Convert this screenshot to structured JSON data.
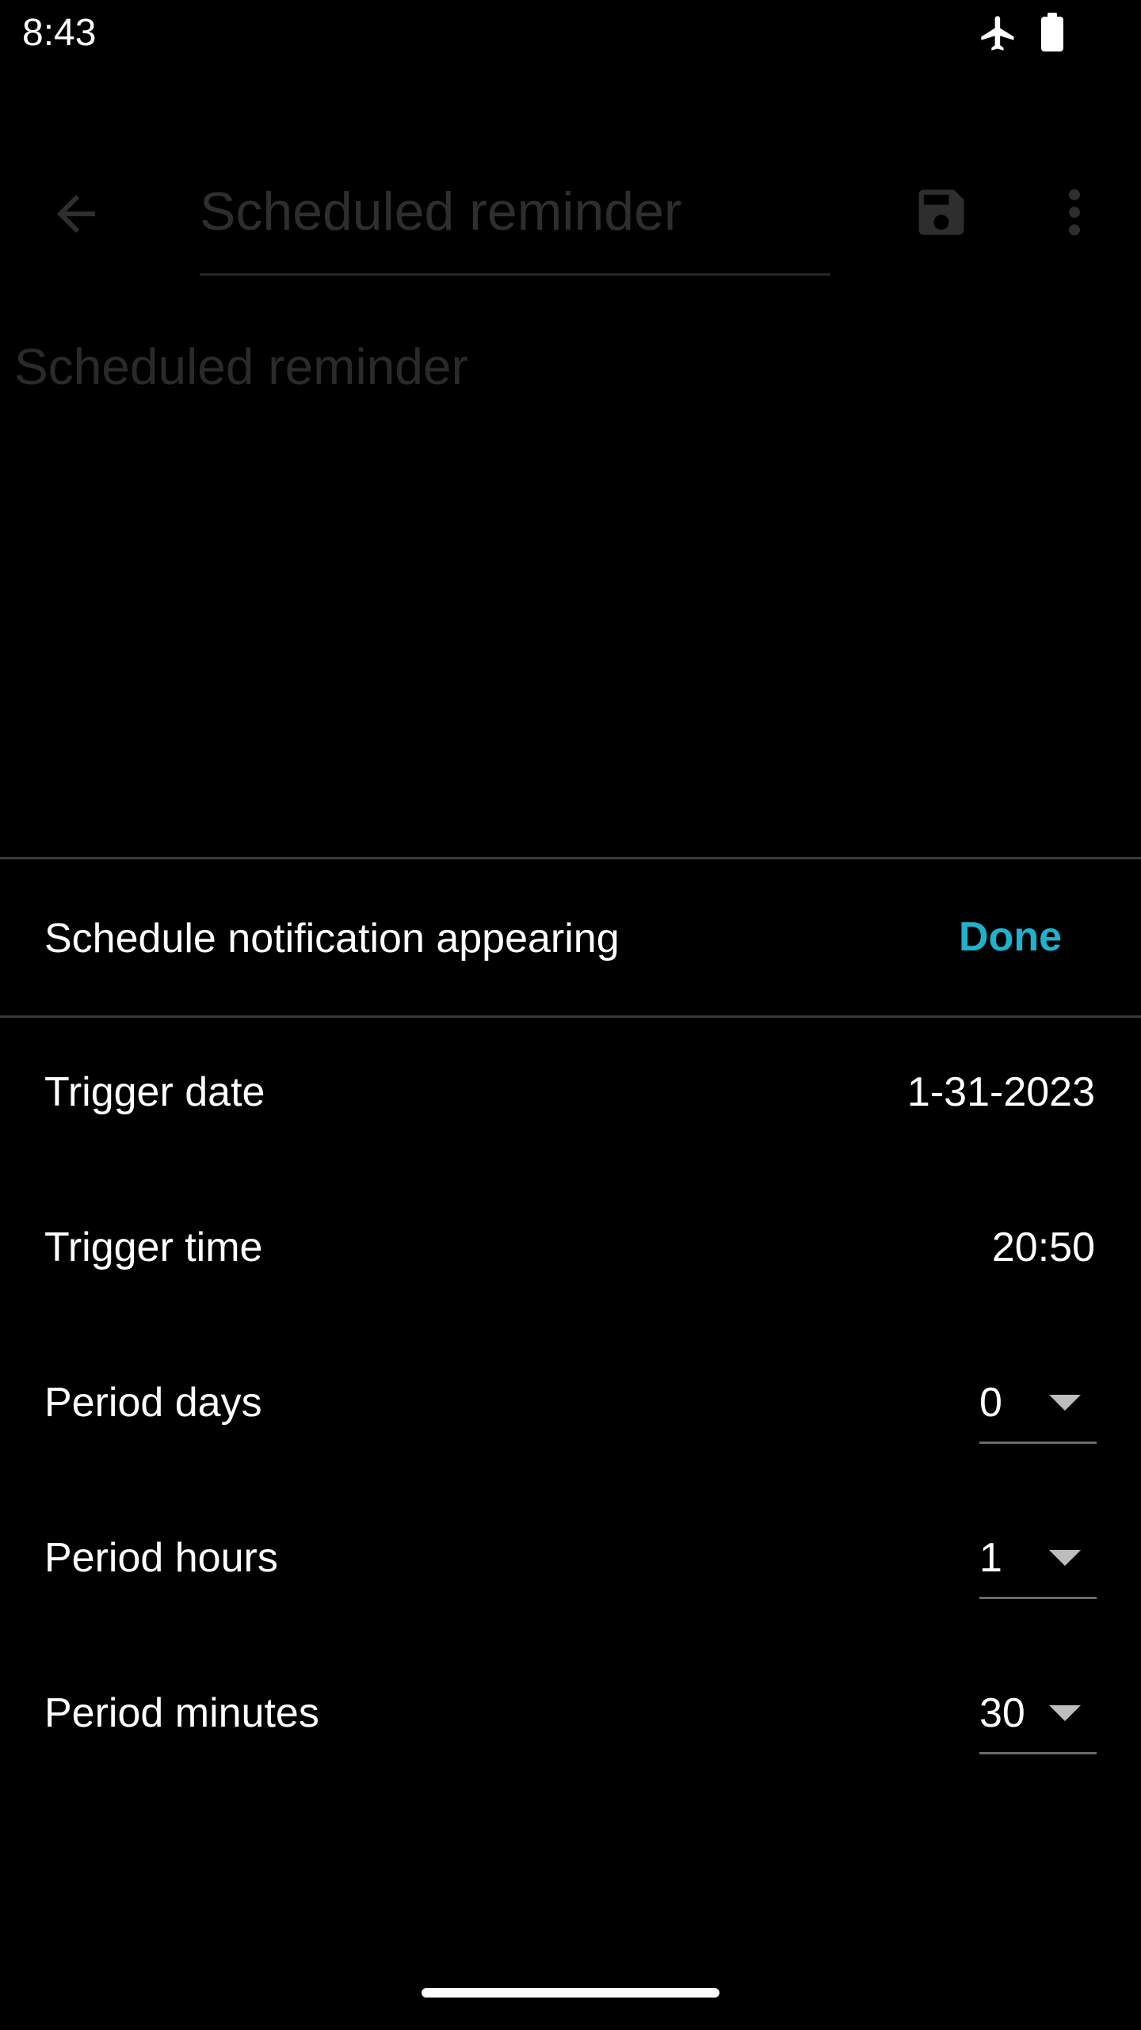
{
  "status_bar": {
    "time": "8:43"
  },
  "background": {
    "title_input_value": "Scheduled reminder",
    "heading": "Scheduled reminder"
  },
  "sheet": {
    "title": "Schedule notification appearing",
    "done_label": "Done",
    "rows": [
      {
        "label": "Trigger date",
        "value": "1-31-2023"
      },
      {
        "label": "Trigger time",
        "value": "20:50"
      },
      {
        "label": "Period days",
        "value": "0"
      },
      {
        "label": "Period hours",
        "value": "1"
      },
      {
        "label": "Period minutes",
        "value": "30"
      }
    ]
  },
  "colors": {
    "accent": "#20b2cc",
    "background": "#000000",
    "text": "#ffffff"
  }
}
